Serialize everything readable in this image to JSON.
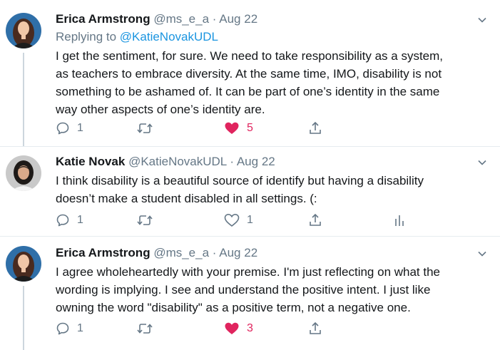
{
  "colors": {
    "text": "#14171a",
    "muted": "#657786",
    "link": "#1b95e0",
    "like": "#e0245e",
    "divider": "#e6ecf0"
  },
  "tweets": [
    {
      "name": "Erica Armstrong",
      "handle": "@ms_e_a",
      "sep": "·",
      "date": "Aug 22",
      "reply_prefix": "Replying to",
      "reply_to": "@KatieNovakUDL",
      "lines": [
        "I get the sentiment, for sure. We need to take responsibility as a system,",
        "as teachers to embrace diversity. At the same time, IMO, disability is not",
        "something to be ashamed of. It can be part of one’s identity in the same",
        "way other aspects of one’s identity are."
      ],
      "replies": "1",
      "retweets": "",
      "likes": "5",
      "liked": true,
      "avatar_icon": "avatar-icon"
    },
    {
      "name": "Katie Novak",
      "handle": "@KatieNovakUDL",
      "sep": "·",
      "date": "Aug 22",
      "lines": [
        "I think disability is a beautiful source of identify but having a disability",
        "doesn’t make a student disabled in all settings. (:"
      ],
      "replies": "1",
      "retweets": "",
      "likes": "1",
      "liked": false,
      "avatar_icon": "avatar-icon"
    },
    {
      "name": "Erica Armstrong",
      "handle": "@ms_e_a",
      "sep": "·",
      "date": "Aug 22",
      "lines": [
        "I agree wholeheartedly with your premise. I'm just reflecting on what the",
        "wording is implying. I see and understand the positive intent. I just like",
        "owning the word \"disability\" as a positive term, not a negative one."
      ],
      "replies": "1",
      "retweets": "",
      "likes": "3",
      "liked": true,
      "avatar_icon": "avatar-icon"
    }
  ]
}
